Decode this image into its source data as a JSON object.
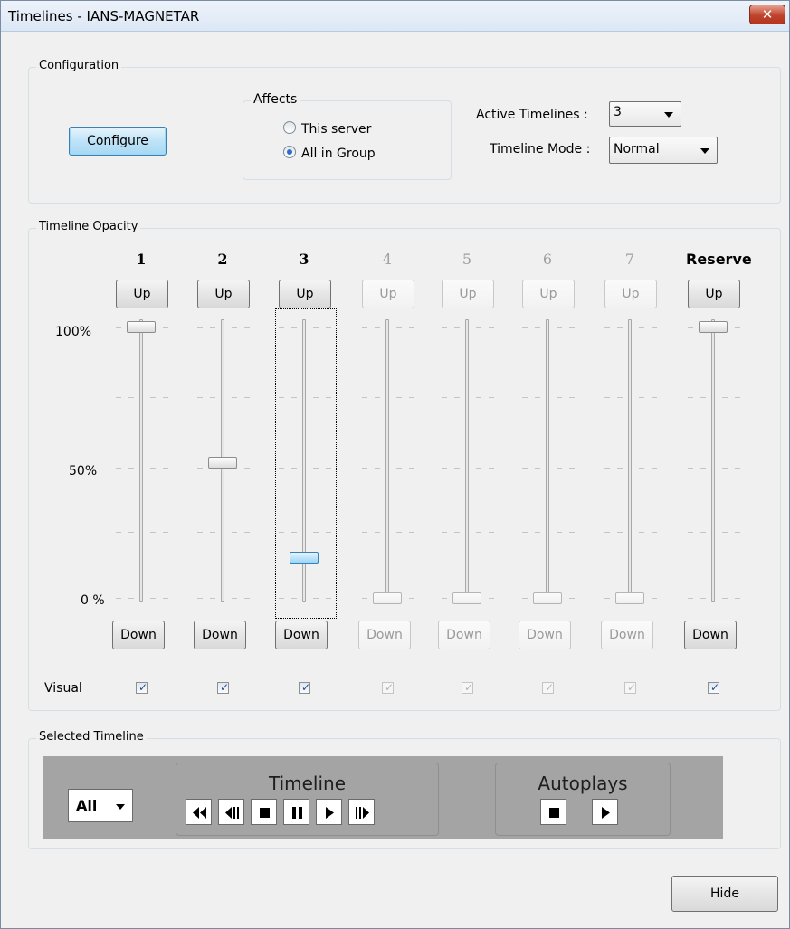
{
  "window": {
    "title": "Timelines - IANS-MAGNETAR",
    "close_label": "✕"
  },
  "configuration": {
    "group_label": "Configuration",
    "configure_label": "Configure",
    "affects": {
      "label": "Affects",
      "options": [
        "This server",
        "All in Group"
      ],
      "selected": "All in Group"
    },
    "active_timelines": {
      "label": "Active Timelines :",
      "value": "3"
    },
    "timeline_mode": {
      "label": "Timeline Mode :",
      "value": "Normal"
    }
  },
  "opacity": {
    "group_label": "Timeline Opacity",
    "scale_labels": [
      "100%",
      "50%",
      "0 %"
    ],
    "up_label": "Up",
    "down_label": "Down",
    "visual_label": "Visual",
    "columns": [
      {
        "header": "1",
        "enabled": true,
        "value": 1.0,
        "visual": true
      },
      {
        "header": "2",
        "enabled": true,
        "value": 0.5,
        "visual": true
      },
      {
        "header": "3",
        "enabled": true,
        "value": 0.15,
        "visual": true,
        "focused": true
      },
      {
        "header": "4",
        "enabled": false,
        "value": 0.0,
        "visual": true
      },
      {
        "header": "5",
        "enabled": false,
        "value": 0.0,
        "visual": true
      },
      {
        "header": "6",
        "enabled": false,
        "value": 0.0,
        "visual": true
      },
      {
        "header": "7",
        "enabled": false,
        "value": 0.0,
        "visual": true
      },
      {
        "header": "Reserve",
        "enabled": true,
        "value": 1.0,
        "visual": true
      }
    ]
  },
  "selected_timeline": {
    "group_label": "Selected Timeline",
    "target": "All",
    "timeline_title": "Timeline",
    "autoplays_title": "Autoplays",
    "timeline_buttons": [
      "rewind-icon",
      "step-back-icon",
      "stop-icon",
      "pause-icon",
      "play-icon",
      "step-forward-icon"
    ],
    "autoplay_buttons": [
      "stop-icon",
      "play-icon"
    ]
  },
  "footer": {
    "hide_label": "Hide"
  },
  "colors": {
    "player_bg": "#a4a4a4",
    "focus_blue": "#3c7fb1",
    "close_red": "#c0432b"
  }
}
